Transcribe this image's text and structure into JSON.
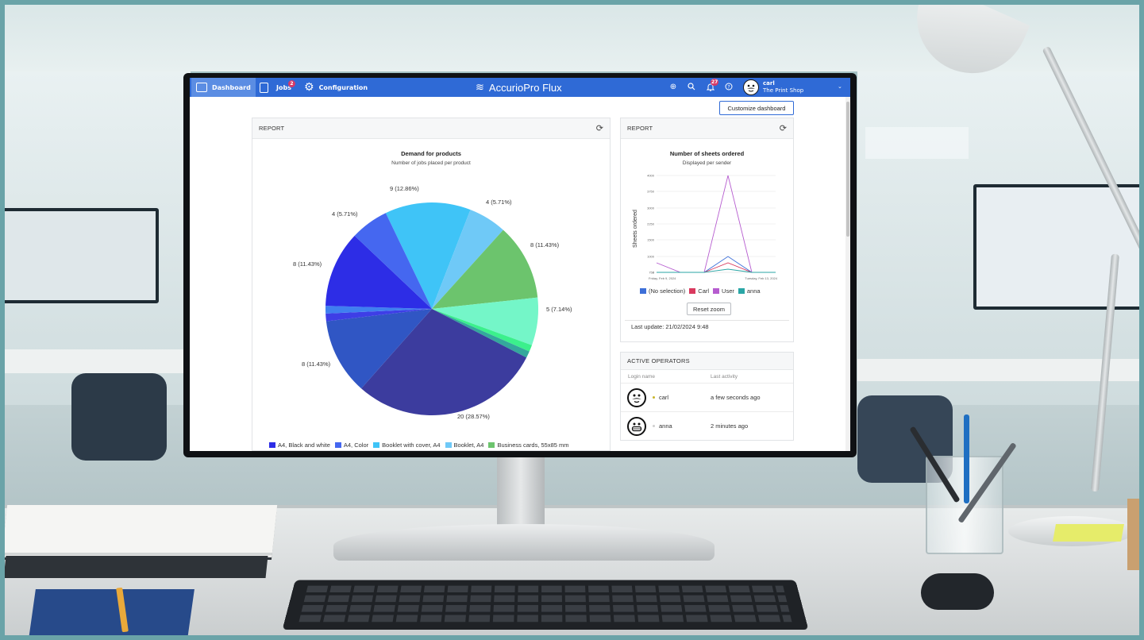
{
  "nav": {
    "tabs": [
      {
        "label": "Dashboard",
        "icon": "dashboard-icon"
      },
      {
        "label": "Jobs",
        "icon": "jobs-icon",
        "badge": "2"
      },
      {
        "label": "Configuration",
        "icon": "gear-icon"
      }
    ],
    "brand": "AccurioPro Flux",
    "notifications_count": "27",
    "user": {
      "name": "carl",
      "org": "The Print Shop"
    },
    "accent": "#2f6ad6"
  },
  "customize_label": "Customize dashboard",
  "report1": {
    "panel_title": "REPORT",
    "chart_data": {
      "type": "pie",
      "title": "Demand for products",
      "subtitle": "Number of jobs placed per product",
      "slices": [
        {
          "label": "9 (12.86%)",
          "value": 9,
          "color": "#3fc4f7"
        },
        {
          "label": "4 (5.71%)",
          "value": 4,
          "color": "#6fc9f7"
        },
        {
          "label": "8 (11.43%)",
          "value": 8,
          "color": "#6cc46d"
        },
        {
          "label": "5 (7.14%)",
          "value": 5,
          "color": "#74f6c8"
        },
        {
          "label": "",
          "value": 0.7,
          "color": "#3bf08c"
        },
        {
          "label": "",
          "value": 0.7,
          "color": "#34a89c"
        },
        {
          "label": "20 (28.57%)",
          "value": 20,
          "color": "#3c3c9e"
        },
        {
          "label": "8 (11.43%)",
          "value": 8,
          "color": "#3056c4"
        },
        {
          "label": "",
          "value": 0.8,
          "color": "#3e3ee6"
        },
        {
          "label": "",
          "value": 0.8,
          "color": "#3f7ff0"
        },
        {
          "label": "8 (11.43%)",
          "value": 8,
          "color": "#2d2de6"
        },
        {
          "label": "4 (5.71%)",
          "value": 4,
          "color": "#4567f0"
        }
      ],
      "legend": [
        {
          "label": "A4, Black and white",
          "color": "#2d2de6"
        },
        {
          "label": "A4, Color",
          "color": "#4567f0"
        },
        {
          "label": "Booklet with cover, A4",
          "color": "#3fc4f7"
        },
        {
          "label": "Booklet, A4",
          "color": "#6fc9f7"
        },
        {
          "label": "Business cards, 55x85 mm",
          "color": "#6cc46d"
        }
      ]
    }
  },
  "report2": {
    "panel_title": "REPORT",
    "chart_data": {
      "type": "line",
      "title": "Number of sheets ordered",
      "subtitle": "Displayed per sender",
      "ylabel": "Sheets ordered",
      "ylim": [
        0,
        4000
      ],
      "yticks": [
        "4000",
        "3750",
        "3000",
        "2250",
        "1500",
        "1000",
        "750",
        "0"
      ],
      "x": [
        "Friday, Feb 9, 2024",
        "",
        "",
        "",
        "",
        "Tuesday, Feb 13, 2024"
      ],
      "series": [
        {
          "name": "(No selection)",
          "color": "#3d6fd8",
          "values": [
            60,
            0,
            0,
            1000,
            0,
            0
          ]
        },
        {
          "name": "Carl",
          "color": "#d9395e",
          "values": [
            380,
            0,
            0,
            900,
            0,
            0
          ]
        },
        {
          "name": "User",
          "color": "#b65ccf",
          "values": [
            900,
            0,
            0,
            4000,
            0,
            0
          ]
        },
        {
          "name": "anna",
          "color": "#2aa6a6",
          "values": [
            60,
            0,
            0,
            800,
            0,
            0
          ]
        }
      ]
    },
    "reset_label": "Reset zoom",
    "last_update": "Last update: 21/02/2024 9:48"
  },
  "operators": {
    "panel_title": "ACTIVE OPERATORS",
    "col_login": "Login name",
    "col_activity": "Last activity",
    "rows": [
      {
        "name": "carl",
        "activity": "a few seconds ago",
        "status_color": "#c9b52a"
      },
      {
        "name": "anna",
        "activity": "2 minutes ago",
        "status_color": "#cfcfcf"
      }
    ]
  }
}
